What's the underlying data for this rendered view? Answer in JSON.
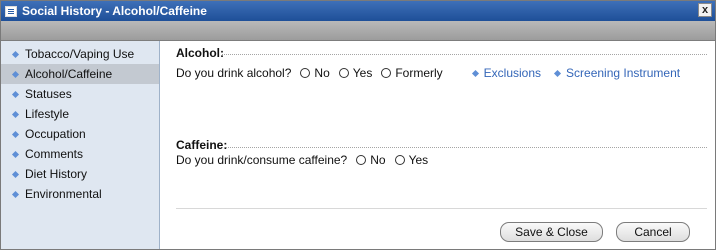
{
  "window": {
    "title": "Social History - Alcohol/Caffeine",
    "close_label": "x"
  },
  "sidebar": {
    "items": [
      {
        "label": "Tobacco/Vaping Use"
      },
      {
        "label": "Alcohol/Caffeine"
      },
      {
        "label": "Statuses"
      },
      {
        "label": "Lifestyle"
      },
      {
        "label": "Occupation"
      },
      {
        "label": "Comments"
      },
      {
        "label": "Diet History"
      },
      {
        "label": "Environmental"
      }
    ],
    "active_item": "Alcohol/Caffeine"
  },
  "alcohol": {
    "header": "Alcohol:",
    "question": "Do you drink alcohol?",
    "options": [
      "No",
      "Yes",
      "Formerly"
    ],
    "links": [
      "Exclusions",
      "Screening Instrument"
    ]
  },
  "caffeine": {
    "header": "Caffeine:",
    "question": "Do you drink/consume caffeine?",
    "options": [
      "No",
      "Yes"
    ]
  },
  "buttons": {
    "save_close": "Save & Close",
    "cancel": "Cancel"
  },
  "colors": {
    "title_bar": "#1e4f98",
    "link": "#3466b8",
    "sidebar_bg": "#dfe7f1",
    "sidebar_active": "#c3c9d1",
    "bullet": "#5f8fd6"
  }
}
